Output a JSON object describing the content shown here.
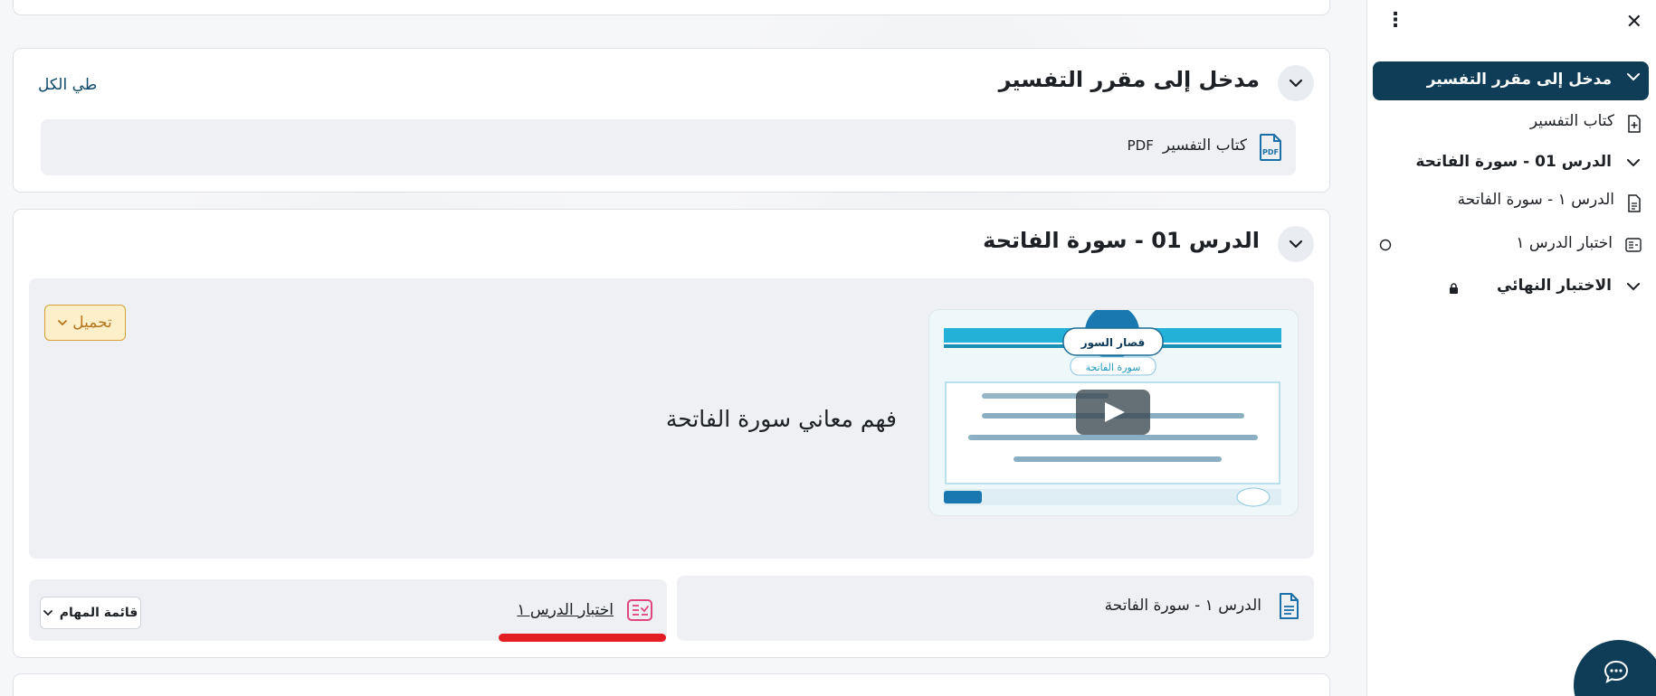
{
  "course_index": {
    "close_icon": "close-icon",
    "menu_icon": "kebab-menu-icon",
    "items": [
      {
        "label": "مدخل إلى مقرر التفسير",
        "type": "section",
        "active": true
      },
      {
        "label": "كتاب التفسير",
        "type": "book"
      },
      {
        "label": "الدرس 01 - سورة الفاتحة",
        "type": "section"
      },
      {
        "label": "الدرس ١ - سورة الفاتحة",
        "type": "page"
      },
      {
        "label": "اختبار الدرس ١",
        "type": "quiz"
      },
      {
        "label": "الاختبار النهائي",
        "type": "section",
        "locked": true
      }
    ]
  },
  "sections": {
    "intro": {
      "title": "مدخل إلى مقرر التفسير",
      "collapse_all": "طي الكل",
      "activity": {
        "name": "كتاب التفسير",
        "badge": "PDF",
        "icon": "pdf-icon"
      }
    },
    "lesson1": {
      "title": "الدرس 01 - سورة الفاتحة",
      "video_title": "قصار السور",
      "video_subtitle": "سورة الفاتحة",
      "description": "فهم معاني سورة الفاتحة",
      "download_label": "تحميل",
      "page_activity": "الدرس ١ - سورة الفاتحة",
      "quiz_activity": "اختبار الدرس ١",
      "task_menu": "قائمة المهام"
    }
  },
  "colors": {
    "primary": "#0f3d57",
    "link": "#0f4a6b",
    "pdf_icon": "#1a6fa8",
    "quiz_icon": "#e0457b",
    "highlight": "#e21d23",
    "download_bg": "#fcefc9",
    "download_border": "#d8a23a"
  }
}
